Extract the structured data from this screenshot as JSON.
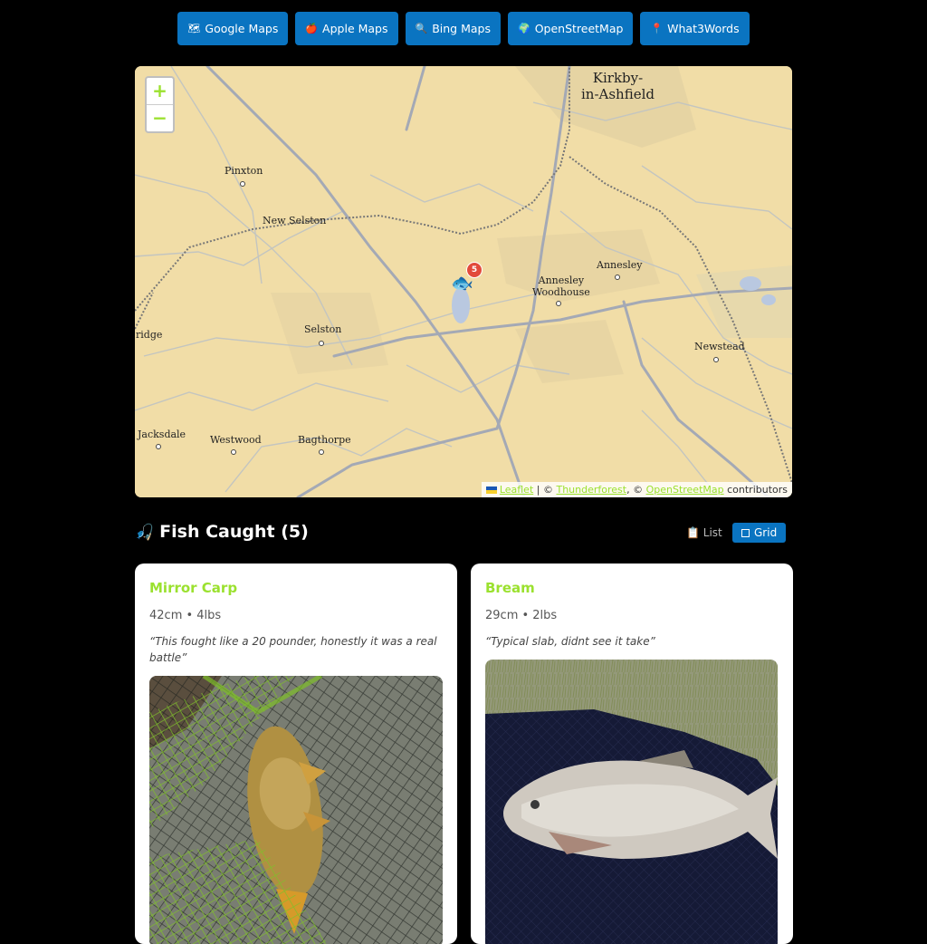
{
  "nav": {
    "buttons": [
      {
        "icon": "🗺",
        "label": "Google Maps"
      },
      {
        "icon": "🍎",
        "label": "Apple Maps"
      },
      {
        "icon": "🔍",
        "label": "Bing Maps"
      },
      {
        "icon": "🌍",
        "label": "OpenStreetMap"
      },
      {
        "icon": "📍",
        "label": "What3Words"
      }
    ]
  },
  "map": {
    "zoom_in": "+",
    "zoom_out": "−",
    "places": {
      "kirkby": "Kirkby-\nin-Ashfield",
      "pinxton": "Pinxton",
      "new_selston": "New Selston",
      "annesley_woodhouse": "Annesley\nWoodhouse",
      "annesley": "Annesley",
      "ridge": "ridge",
      "selston": "Selston",
      "newstead": "Newstead",
      "jacksdale": "Jacksdale",
      "westwood": "Westwood",
      "bagthorpe": "Bagthorpe"
    },
    "marker_icon": "🐟",
    "marker_count": "5",
    "attribution": {
      "leaflet": "Leaflet",
      "sep1": " | © ",
      "thunderforest": "Thunderforest",
      "sep2": ", © ",
      "osm": "OpenStreetMap",
      "suffix": " contributors"
    }
  },
  "catches": {
    "icon": "🎣",
    "title": "Fish Caught (5)",
    "view_list_icon": "📋",
    "view_list": "List",
    "view_grid": "Grid",
    "items": [
      {
        "name": "Mirror Carp",
        "meta": "42cm • 4lbs",
        "quote": "“This fought like a 20 pounder, honestly it was a real battle”"
      },
      {
        "name": "Bream",
        "meta": "29cm • 2lbs",
        "quote": "“Typical slab, didnt see it take”"
      }
    ]
  },
  "colors": {
    "accent": "#9be12f",
    "button": "#0a74c1",
    "map_bg": "#f1dda7"
  }
}
